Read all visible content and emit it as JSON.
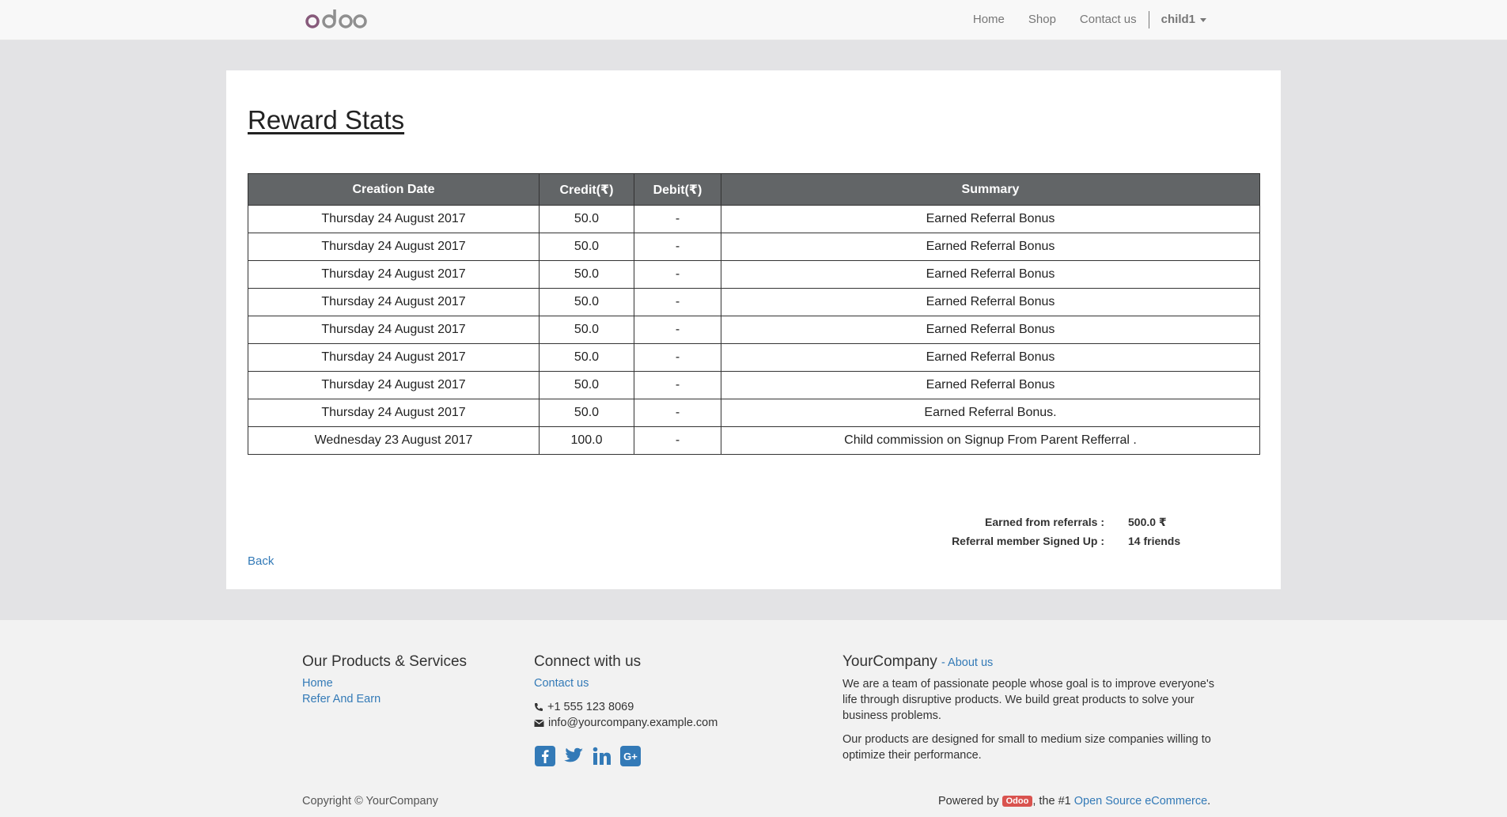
{
  "navbar": {
    "brand": "odoo",
    "items": [
      "Home",
      "Shop",
      "Contact us"
    ],
    "user": "child1"
  },
  "page": {
    "title": "Reward Stats",
    "table": {
      "headers": [
        "Creation Date",
        "Credit(₹)",
        "Debit(₹)",
        "Summary"
      ],
      "rows": [
        [
          "Thursday 24 August 2017",
          "50.0",
          "-",
          "Earned Referral Bonus"
        ],
        [
          "Thursday 24 August 2017",
          "50.0",
          "-",
          "Earned Referral Bonus"
        ],
        [
          "Thursday 24 August 2017",
          "50.0",
          "-",
          "Earned Referral Bonus"
        ],
        [
          "Thursday 24 August 2017",
          "50.0",
          "-",
          "Earned Referral Bonus"
        ],
        [
          "Thursday 24 August 2017",
          "50.0",
          "-",
          "Earned Referral Bonus"
        ],
        [
          "Thursday 24 August 2017",
          "50.0",
          "-",
          "Earned Referral Bonus"
        ],
        [
          "Thursday 24 August 2017",
          "50.0",
          "-",
          "Earned Referral Bonus"
        ],
        [
          "Thursday 24 August 2017",
          "50.0",
          "-",
          "Earned Referral Bonus."
        ],
        [
          "Wednesday 23 August 2017",
          "100.0",
          "-",
          "Child commission on Signup From Parent Refferral ."
        ]
      ]
    },
    "stats": {
      "earned_label": "Earned from referrals :",
      "earned_value": "500.0 ₹",
      "signed_label": "Referral member Signed Up :",
      "signed_value": "14 friends"
    },
    "back_label": "Back"
  },
  "footer": {
    "products": {
      "heading": "Our Products & Services",
      "links": [
        "Home",
        "Refer And Earn"
      ]
    },
    "connect": {
      "heading": "Connect with us",
      "contact_label": "Contact us",
      "phone": "+1 555 123 8069",
      "email": "info@yourcompany.example.com",
      "social_icons": [
        "facebook-icon",
        "twitter-icon",
        "linkedin-icon",
        "google-plus-icon"
      ]
    },
    "company": {
      "name": "YourCompany",
      "about_label": "- About us",
      "para1": "We are a team of passionate people whose goal is to improve everyone's life through disruptive products. We build great products to solve your business problems.",
      "para2": "Our products are designed for small to medium size companies willing to optimize their performance."
    },
    "copyright": "Copyright © YourCompany",
    "powered_prefix": "Powered by",
    "powered_badge": "Odoo",
    "powered_mid": ", the #1",
    "powered_link": "Open Source eCommerce",
    "powered_suffix": "."
  },
  "colors": {
    "table_header_bg": "#626567",
    "link": "#337ab7",
    "odoo_purple": "#875a7b"
  }
}
